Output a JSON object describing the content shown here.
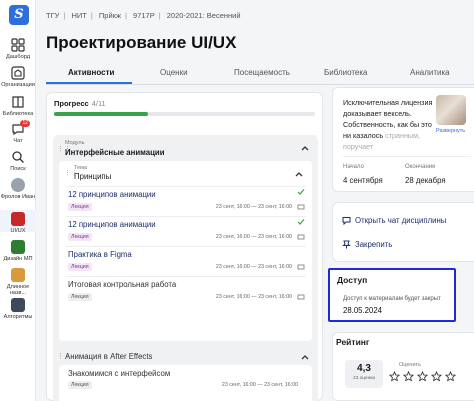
{
  "rail": {
    "items": [
      {
        "label": "Дашборд",
        "icon": "grid-icon"
      },
      {
        "label": "Организации",
        "icon": "home-icon"
      },
      {
        "label": "Библиотека",
        "icon": "book-icon"
      },
      {
        "label": "Чат",
        "icon": "chat-icon",
        "badge": "12"
      },
      {
        "label": "Поиск",
        "icon": "search-icon"
      },
      {
        "label": "Фролов Иван",
        "icon": "avatar-icon"
      },
      {
        "label": "UI/UX",
        "icon": "course-icon"
      },
      {
        "label": "Дизайн МП",
        "icon": "course-icon"
      },
      {
        "label": "Длинное назв...",
        "icon": "course-icon"
      },
      {
        "label": "Алгоритмы",
        "icon": "course-icon"
      }
    ]
  },
  "breadcrumb": [
    "ТГУ",
    "НИТ",
    "Прйкж",
    "9717Р",
    "2020-2021: Весенний"
  ],
  "page_title": "Проектирование UI/UX",
  "tabs": [
    "Активности",
    "Оценки",
    "Посещаемость",
    "Библиотека",
    "Аналитика"
  ],
  "progress": {
    "label": "Прогресс",
    "count": "4/11",
    "fraction": 0.36
  },
  "module1": {
    "sub": "Модуль",
    "title": "Интерфейсные анимации",
    "topic": {
      "sub": "Тема",
      "title": "Принципы",
      "lessons": [
        {
          "title": "12 принципов анимации",
          "tag": "Лекция",
          "date": "23 сент, 16:00 — 23 сент, 16:00",
          "status": "check-icon"
        },
        {
          "title": "12 принципов анимации",
          "tag": "Лекция",
          "date": "23 сент, 16:00 — 23 сент, 16:00",
          "status": "check-icon"
        },
        {
          "title": "Практика в Figma",
          "tag": "Лекция",
          "date": "23 сент, 16:00 — 23 сент, 16:00",
          "status": "message-icon"
        },
        {
          "title": "Итоговая контрольная работа",
          "tag": "Лекция",
          "date": "23 сент, 16:00 — 23 сент, 16:00",
          "status": "message-icon"
        }
      ]
    }
  },
  "module2": {
    "title": "Анимация в After Effects",
    "lesson": {
      "title": "Знакомимся с интерфейсом",
      "tag": "Лекция",
      "date": "23 сент, 16:00 — 23 сент, 16:00"
    }
  },
  "info": {
    "text_main": "Исключительная лицензия доказывает вексель. Собственность, как бы это ни казалось",
    "text_fade": "странным, поручает",
    "link": "Развернуть",
    "start_label": "Начало",
    "start_value": "4 сентября",
    "end_label": "Окончание",
    "end_value": "28 декабря"
  },
  "actions": {
    "chat": "Открыть чат дисциплины",
    "pin": "Закрепить"
  },
  "access": {
    "title": "Доступ",
    "sub": "Доступ к материалам будет закрыт",
    "date": "28.05.2024"
  },
  "rating": {
    "title": "Рейтинг",
    "value": "4,3",
    "count": "23 оценки",
    "label": "Оценить",
    "stars": 5
  },
  "colors": {
    "accent": "#2f6fdc",
    "progress": "#3aa34a",
    "highlight_border": "#1f2bd6"
  }
}
